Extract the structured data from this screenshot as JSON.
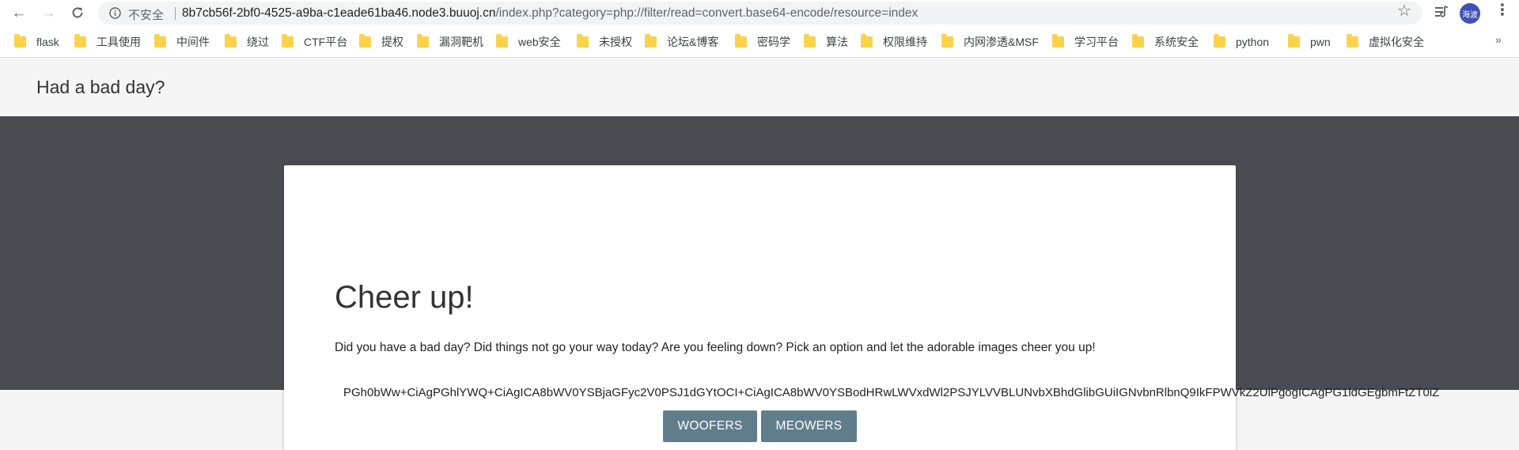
{
  "browser": {
    "security_label": "不安全",
    "url_host": "8b7cb56f-2bf0-4525-a9ba-c1eade61ba46.node3.buuoj.cn",
    "url_path": "/index.php?category=php://filter/read=convert.base64-encode/resource=index",
    "avatar_text": "海波",
    "icons": [
      "back-arrow-icon",
      "forward-arrow-icon",
      "reload-icon",
      "info-icon",
      "star-icon",
      "media-control-icon",
      "kebab-menu-icon"
    ]
  },
  "bookmarks": [
    {
      "label": "flask"
    },
    {
      "label": "工具使用"
    },
    {
      "label": "中间件"
    },
    {
      "label": "绕过"
    },
    {
      "label": "CTF平台"
    },
    {
      "label": "提权"
    },
    {
      "label": "漏洞靶机"
    },
    {
      "label": "web安全"
    },
    {
      "label": "未授权"
    },
    {
      "label": "论坛&博客"
    },
    {
      "label": "密码学"
    },
    {
      "label": "算法"
    },
    {
      "label": "权限维持"
    },
    {
      "label": "内网渗透&MSF"
    },
    {
      "label": "学习平台"
    },
    {
      "label": "系统安全"
    },
    {
      "label": "python"
    },
    {
      "label": "pwn"
    },
    {
      "label": "虚拟化安全"
    }
  ],
  "bookmarks_overflow": "»",
  "page": {
    "site_title": "Had a bad day?",
    "heading": "Cheer up!",
    "intro": "Did you have a bad day? Did things not go your way today? Are you feeling down? Pick an option and let the adorable images cheer you up!",
    "output": "PGh0bWw+CiAgPGhlYWQ+CiAgICA8bWV0YSBjaGFyc2V0PSJ1dGYtOCI+CiAgICA8bWV0YSBodHRwLWVxdWl2PSJYLVVBLUNvbXBhdGlibGUiIGNvbnRlbnQ9IkFPWVkZ2UiPgogICAgPG1ldGEgbmFtZT0iZ",
    "buttons": {
      "woofers": "WOOFERS",
      "meowers": "MEOWERS"
    }
  },
  "colors": {
    "hero_bg": "#4a4b50",
    "button_bg": "#607d8b",
    "page_bg": "#f5f5f5"
  }
}
